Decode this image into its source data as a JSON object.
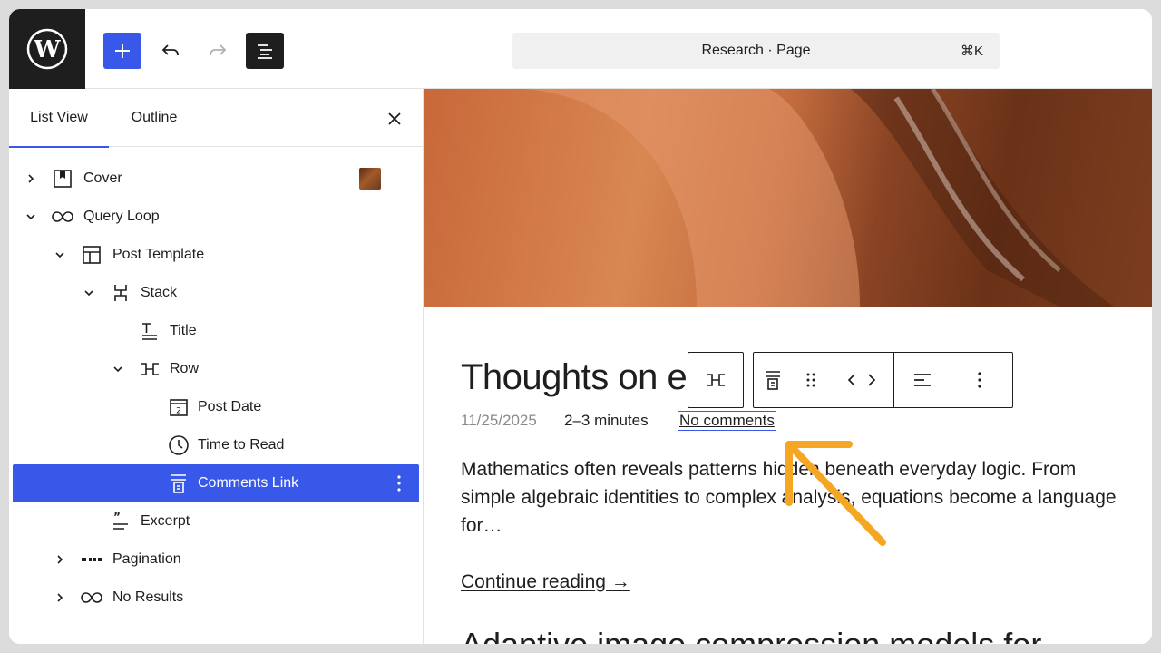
{
  "topbar": {
    "command_label": "Research · Page",
    "command_shortcut": "⌘K"
  },
  "sidebar": {
    "tabs": [
      {
        "label": "List View",
        "active": true
      },
      {
        "label": "Outline",
        "active": false
      }
    ],
    "tree": [
      {
        "label": "Cover",
        "icon": "cover-icon",
        "expanded": false
      },
      {
        "label": "Query Loop",
        "icon": "loop-icon",
        "expanded": true
      },
      {
        "label": "Post Template",
        "icon": "layout-icon",
        "expanded": true
      },
      {
        "label": "Stack",
        "icon": "stack-icon",
        "expanded": true
      },
      {
        "label": "Title",
        "icon": "title-icon"
      },
      {
        "label": "Row",
        "icon": "row-icon",
        "expanded": true
      },
      {
        "label": "Post Date",
        "icon": "calendar-icon"
      },
      {
        "label": "Time to Read",
        "icon": "clock-icon"
      },
      {
        "label": "Comments Link",
        "icon": "comments-link-icon",
        "selected": true
      },
      {
        "label": "Excerpt",
        "icon": "excerpt-icon"
      },
      {
        "label": "Pagination",
        "icon": "pagination-icon",
        "expanded": false
      },
      {
        "label": "No Results",
        "icon": "loop-icon",
        "expanded": false
      }
    ]
  },
  "canvas": {
    "post_title": "Thoughts on e",
    "post_date": "11/25/2025",
    "read_time": "2–3 minutes",
    "comments": "No comments",
    "excerpt": "Mathematics often reveals patterns hidden beneath everyday logic. From simple algebraic identities to complex analysis, equations become a language for…",
    "continue_reading": "Continue reading →",
    "next_title": "Adaptive image compression models for"
  },
  "colors": {
    "accent": "#3858e9",
    "annotation_arrow": "#f5a623"
  }
}
